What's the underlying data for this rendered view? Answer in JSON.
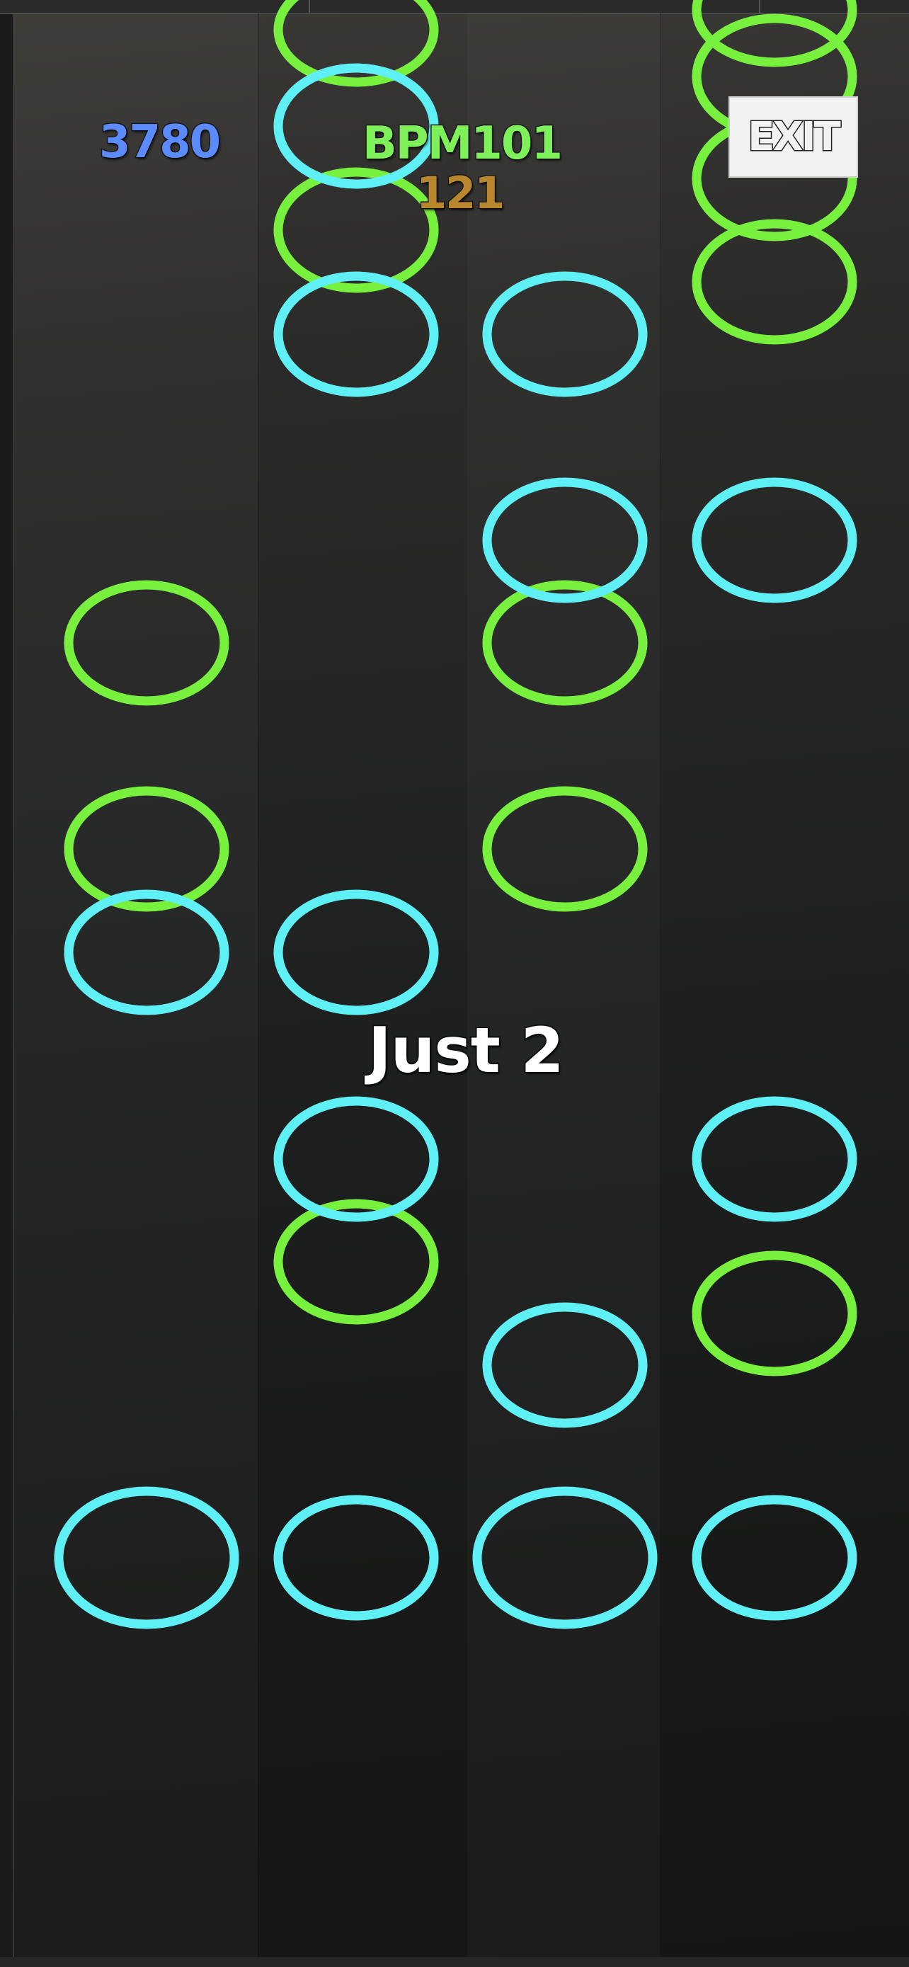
{
  "hud": {
    "score": "3780",
    "bpm": "BPM101",
    "combo": "121",
    "judgement": "Just 2",
    "exit_label": "EXIT"
  },
  "colors": {
    "score": "#5b8bff",
    "bpm": "#7ef05a",
    "combo": "#b8862c",
    "note_cyan": "#5ff0f5",
    "note_green": "#78f03e"
  },
  "note_types": [
    "cyan-ring",
    "green-ring"
  ],
  "lane_count": 4
}
